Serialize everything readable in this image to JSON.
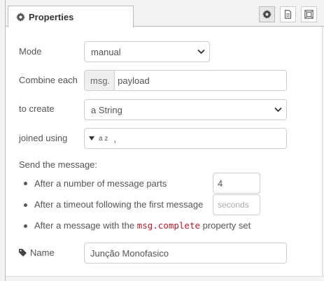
{
  "tab": {
    "label": "Properties"
  },
  "icons": {
    "tab": "gear-icon",
    "buttons": [
      "gear-icon",
      "document-icon",
      "frame-icon"
    ],
    "name": "tag-icon",
    "string_type": "az-string-icon"
  },
  "form": {
    "mode": {
      "label": "Mode",
      "value": "manual"
    },
    "combine": {
      "label": "Combine each",
      "prefix": "msg.",
      "value": "payload"
    },
    "create": {
      "label": "to create",
      "value": "a String"
    },
    "joined": {
      "label": "joined using",
      "type_glyph": "a z",
      "value": ","
    },
    "send_label": "Send the message:",
    "bullets": {
      "parts": {
        "text": "After a number of message parts",
        "value": "4"
      },
      "timeout": {
        "text": "After a timeout following the first message",
        "placeholder": "seconds"
      },
      "complete": {
        "before": "After a message with the ",
        "code": "msg.complete",
        "after": " property set"
      }
    },
    "name": {
      "label": "Name",
      "value": "Junção Monofasico"
    }
  },
  "colors": {
    "code_text": "#aa1d2b",
    "border": "#cccccc",
    "panel_bg": "#f3f3f3"
  }
}
